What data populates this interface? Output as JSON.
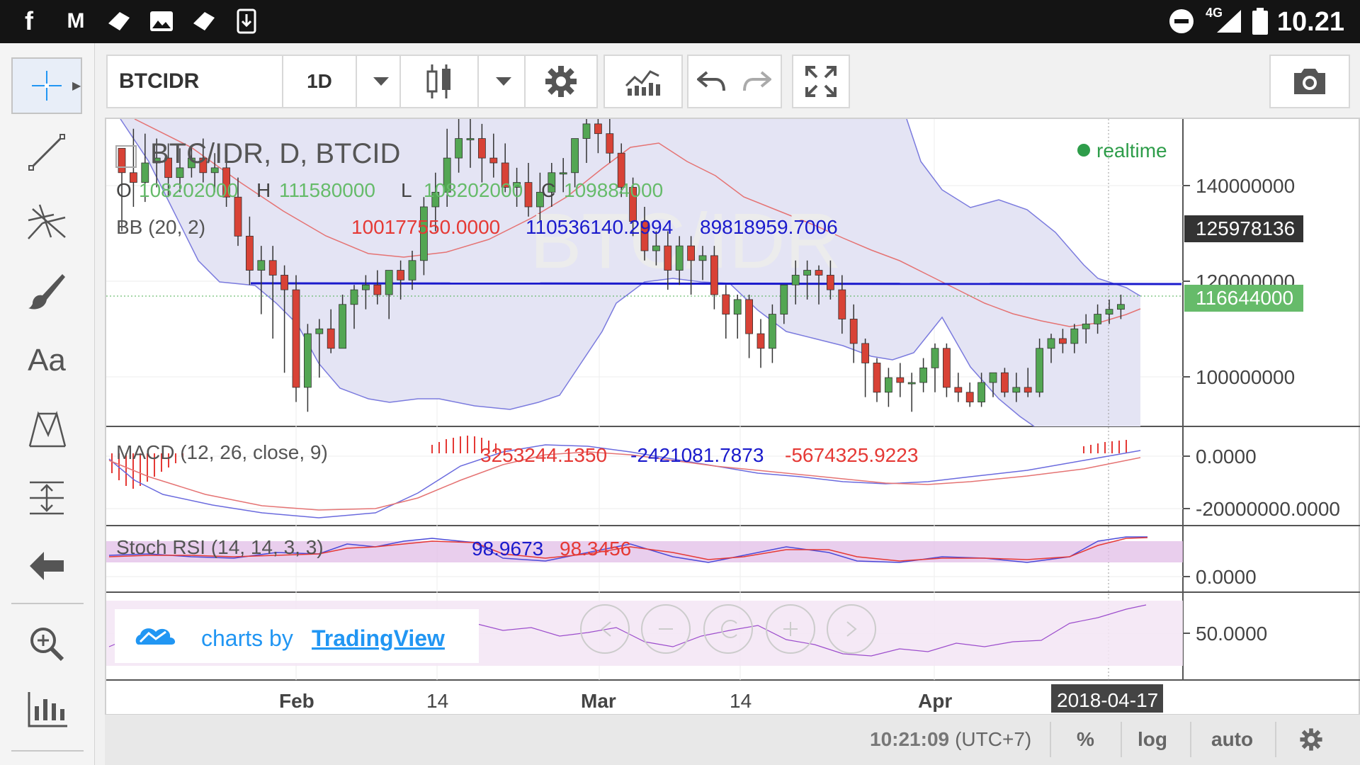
{
  "status_bar": {
    "time": "10.21",
    "network": "4G",
    "icons": [
      "facebook-icon",
      "gmail-icon",
      "ticket-icon",
      "image-icon",
      "ticket-icon",
      "download-icon",
      "dnd-icon",
      "signal-icon",
      "battery-icon"
    ]
  },
  "toolbar": {
    "symbol": "BTCIDR",
    "interval": "1D",
    "chart_style_icon": "candlestick-icon",
    "settings_icon": "gear-icon",
    "indicators_icon": "indicators-icon",
    "undo_icon": "undo-icon",
    "redo_icon": "redo-icon",
    "fullscreen_icon": "fullscreen-icon",
    "snapshot_icon": "camera-icon"
  },
  "left_tools": [
    "crosshair-icon",
    "trend-line-icon",
    "pitchfork-icon",
    "brush-icon",
    "Aa",
    "pattern-icon",
    "measure-icon",
    "back-arrow-icon",
    "zoom-icon",
    "ruler-icon"
  ],
  "main_pane": {
    "title": "BTC/IDR, D, BTCID",
    "watermark": "BTC/IDR",
    "realtime": "realtime",
    "ohlc": {
      "o_label": "O",
      "o": "108202000",
      "h_label": "H",
      "h": "111580000",
      "l_label": "L",
      "l": "108202000",
      "c_label": "C",
      "c": "109884000"
    },
    "bb_label": "BB (20, 2)",
    "bb_values": {
      "middle": "100177550.0000",
      "upper": "110536140.2994",
      "lower": "89818959.7006"
    },
    "price_axis": [
      "140000000",
      "120000000",
      "100000000"
    ],
    "price_labels": {
      "upper_tag": "125978136",
      "last_tag": "116644000"
    },
    "horizontal_line": 116000000
  },
  "macd_pane": {
    "label": "MACD (12, 26, close, 9)",
    "values": {
      "histogram": "3253244.1350",
      "macd": "-2421081.7873",
      "signal": "-5674325.9223"
    },
    "axis": [
      "0.0000",
      "-20000000.0000"
    ]
  },
  "stoch_pane": {
    "label": "Stoch RSI (14, 14, 3, 3)",
    "values": {
      "k": "98.9673",
      "d": "98.3456"
    },
    "axis": [
      "0.0000"
    ]
  },
  "rsi_pane": {
    "axis": [
      "50.0000"
    ],
    "branding": {
      "prefix": "charts by",
      "brand": "TradingView"
    }
  },
  "time_axis": {
    "labels": [
      "Feb",
      "14",
      "Mar",
      "14",
      "Apr"
    ],
    "cursor_date": "2018-04-17"
  },
  "bottom_bar": {
    "clock": "10:21:09",
    "timezone": "(UTC+7)",
    "percent": "%",
    "log": "log",
    "auto": "auto",
    "settings_icon": "gear-icon"
  },
  "chart_data": {
    "type": "candlestick",
    "symbol": "BTC/IDR",
    "interval": "D",
    "x_labels": [
      "Feb",
      "14",
      "Mar",
      "14",
      "Apr",
      "2018-04-17"
    ],
    "ylim": [
      85000000,
      148000000
    ],
    "candles": [
      [
        142,
        142,
        125,
        137
      ],
      [
        137,
        146,
        130,
        135
      ],
      [
        135,
        145,
        131,
        139
      ],
      [
        139,
        144,
        134,
        140
      ],
      [
        140,
        143,
        132,
        136
      ],
      [
        136,
        142,
        133,
        138
      ],
      [
        138,
        142,
        136,
        140
      ],
      [
        140,
        144,
        135,
        137
      ],
      [
        137,
        141,
        133,
        138
      ],
      [
        138,
        141,
        130,
        132
      ],
      [
        132,
        136,
        122,
        124
      ],
      [
        124,
        128,
        114,
        117
      ],
      [
        117,
        122,
        108,
        119
      ],
      [
        119,
        122,
        103,
        116
      ],
      [
        116,
        118,
        96,
        113
      ],
      [
        113,
        116,
        90,
        93
      ],
      [
        93,
        106,
        88,
        104
      ],
      [
        104,
        107,
        95,
        105
      ],
      [
        105,
        109,
        100,
        101
      ],
      [
        101,
        112,
        101,
        110
      ],
      [
        110,
        114,
        105,
        113
      ],
      [
        113,
        116,
        109,
        114
      ],
      [
        114,
        117,
        110,
        112
      ],
      [
        112,
        115,
        107,
        117
      ],
      [
        117,
        119,
        111,
        115
      ],
      [
        115,
        121,
        113,
        119
      ],
      [
        119,
        132,
        116,
        130
      ],
      [
        130,
        137,
        125,
        133
      ],
      [
        133,
        146,
        130,
        140
      ],
      [
        140,
        149,
        137,
        144
      ],
      [
        144,
        150,
        138,
        144
      ],
      [
        144,
        147,
        135,
        140
      ],
      [
        140,
        145,
        136,
        139
      ],
      [
        139,
        143,
        133,
        134
      ],
      [
        134,
        138,
        130,
        135
      ],
      [
        135,
        139,
        128,
        130
      ],
      [
        130,
        137,
        127,
        133
      ],
      [
        133,
        139,
        130,
        137
      ],
      [
        137,
        140,
        133,
        137
      ],
      [
        137,
        144,
        134,
        144
      ],
      [
        144,
        149,
        139,
        147
      ],
      [
        147,
        150,
        141,
        145
      ],
      [
        145,
        148,
        139,
        141
      ],
      [
        141,
        143,
        132,
        134
      ],
      [
        134,
        136,
        124,
        127
      ],
      [
        127,
        130,
        119,
        121
      ],
      [
        121,
        125,
        118,
        122
      ],
      [
        122,
        125,
        113,
        117
      ],
      [
        117,
        124,
        114,
        122
      ],
      [
        122,
        124,
        112,
        119
      ],
      [
        119,
        122,
        115,
        120
      ],
      [
        120,
        122,
        109,
        112
      ],
      [
        112,
        114,
        103,
        108
      ],
      [
        108,
        112,
        103,
        111
      ],
      [
        111,
        112,
        99,
        104
      ],
      [
        104,
        107,
        97,
        101
      ],
      [
        101,
        110,
        98,
        108
      ],
      [
        108,
        114,
        106,
        114
      ],
      [
        114,
        119,
        110,
        116
      ],
      [
        116,
        119,
        111,
        117
      ],
      [
        117,
        118,
        110,
        116
      ],
      [
        116,
        119,
        111,
        113
      ],
      [
        113,
        116,
        104,
        107
      ],
      [
        107,
        110,
        98,
        102
      ],
      [
        102,
        103,
        91,
        98
      ],
      [
        98,
        99,
        90,
        92
      ],
      [
        92,
        97,
        89,
        95
      ],
      [
        95,
        98,
        91,
        94
      ],
      [
        94,
        96,
        88,
        94
      ],
      [
        94,
        99,
        92,
        97
      ],
      [
        97,
        102,
        92,
        101
      ],
      [
        101,
        102,
        91,
        93
      ],
      [
        93,
        96,
        90,
        92
      ],
      [
        92,
        94,
        89,
        90
      ],
      [
        90,
        96,
        89,
        94
      ],
      [
        94,
        96,
        91,
        96
      ],
      [
        96,
        97,
        91,
        92
      ],
      [
        92,
        96,
        90,
        93
      ],
      [
        93,
        97,
        91,
        92
      ],
      [
        92,
        103,
        91,
        101
      ],
      [
        101,
        104,
        98,
        103
      ],
      [
        103,
        105,
        100,
        102
      ],
      [
        102,
        106,
        100,
        105
      ],
      [
        105,
        108,
        102,
        106
      ],
      [
        106,
        110,
        104,
        108
      ],
      [
        108,
        111,
        106,
        109
      ],
      [
        109,
        112,
        107,
        110
      ]
    ]
  }
}
